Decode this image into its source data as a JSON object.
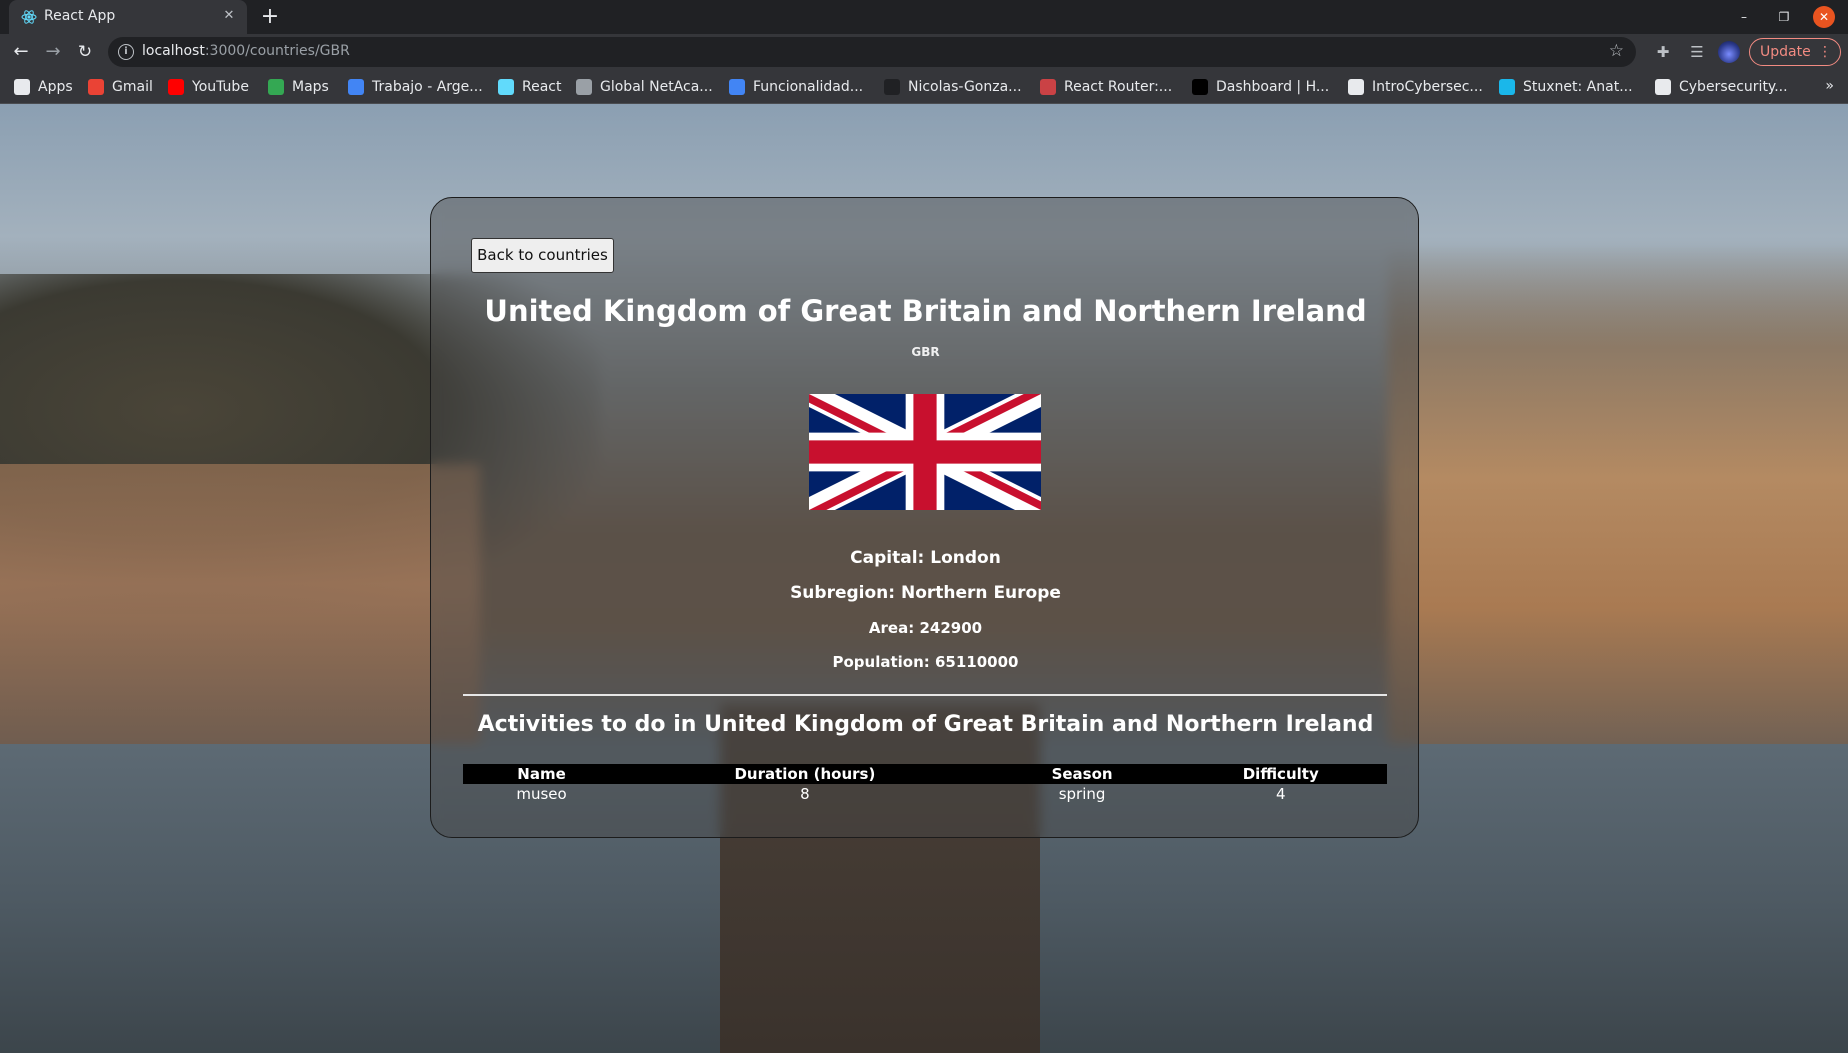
{
  "browser": {
    "tab_title": "React App",
    "url_host": "localhost",
    "url_rest": ":3000/countries/GBR",
    "update_label": "Update",
    "bookmarks": [
      {
        "label": "Apps",
        "icon": "apps-grid-icon",
        "color": "#e8eaed"
      },
      {
        "label": "Gmail",
        "icon": "gmail-icon",
        "color": "#ea4335"
      },
      {
        "label": "YouTube",
        "icon": "youtube-icon",
        "color": "#ff0000"
      },
      {
        "label": "Maps",
        "icon": "maps-icon",
        "color": "#34a853"
      },
      {
        "label": "Trabajo - Arge...",
        "icon": "trabajo-icon",
        "color": "#4285f4"
      },
      {
        "label": "React",
        "icon": "react-icon",
        "color": "#61dafb"
      },
      {
        "label": "Global NetAca...",
        "icon": "netacad-icon",
        "color": "#9aa0a6"
      },
      {
        "label": "Funcionalidad...",
        "icon": "docs-icon",
        "color": "#4285f4"
      },
      {
        "label": "Nicolas-Gonza...",
        "icon": "github-icon",
        "color": "#202124"
      },
      {
        "label": "React Router:...",
        "icon": "react-router-icon",
        "color": "#ca4245"
      },
      {
        "label": "Dashboard | H...",
        "icon": "dashboard-icon",
        "color": "#000000"
      },
      {
        "label": "IntroCybersec...",
        "icon": "globe-icon",
        "color": "#e8eaed"
      },
      {
        "label": "Stuxnet: Anat...",
        "icon": "vimeo-icon",
        "color": "#1ab7ea"
      },
      {
        "label": "Cybersecurity...",
        "icon": "globe-icon",
        "color": "#e8eaed"
      }
    ]
  },
  "page": {
    "back_label": "Back to countries",
    "country_name": "United Kingdom of Great Britain and Northern Ireland",
    "country_code": "GBR",
    "capital": "Capital: London",
    "subregion": "Subregion: Northern Europe",
    "area": "Area: 242900",
    "population": "Population: 65110000",
    "activities_title": "Activities to do in United Kingdom of Great Britain and Northern Ireland",
    "table": {
      "headers": [
        "Name",
        "Duration (hours)",
        "Season",
        "Difficulty"
      ],
      "rows": [
        [
          "museo",
          "8",
          "spring",
          "4"
        ]
      ]
    }
  },
  "colors": {
    "flag_blue": "#012169",
    "flag_red": "#C8102E",
    "accent_update": "#f28b82"
  }
}
